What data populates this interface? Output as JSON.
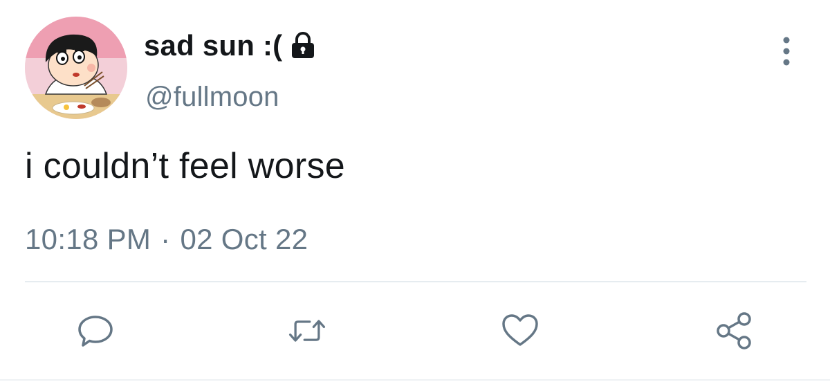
{
  "user": {
    "display_name": "sad sun :(",
    "handle": "@fullmoon",
    "protected_icon": "lock-icon",
    "avatar_icon": "cartoon-avatar"
  },
  "tweet": {
    "text": "i couldn’t feel worse",
    "time": "10:18 PM",
    "separator": "·",
    "date": "02 Oct 22"
  },
  "actions": [
    {
      "name": "reply",
      "icon": "speech-bubble-icon"
    },
    {
      "name": "retweet",
      "icon": "retweet-icon"
    },
    {
      "name": "like",
      "icon": "heart-icon"
    },
    {
      "name": "share",
      "icon": "share-icon"
    }
  ],
  "menu": {
    "icon": "more-vertical-icon"
  },
  "colors": {
    "primary_text": "#14171a",
    "secondary_text": "#657786",
    "divider": "#e6ecf0"
  }
}
